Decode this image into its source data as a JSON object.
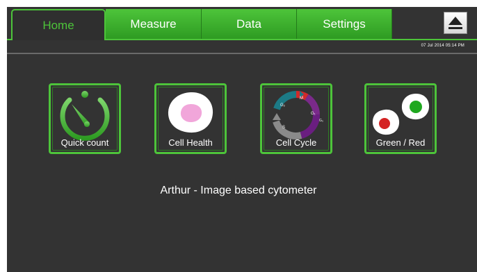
{
  "tabs": [
    {
      "label": "Home",
      "active": true
    },
    {
      "label": "Measure",
      "active": false
    },
    {
      "label": "Data",
      "active": false
    },
    {
      "label": "Settings",
      "active": false
    }
  ],
  "eject_icon": "eject-icon",
  "datetime": "07 Jul 2014  05:14 PM",
  "tiles": [
    {
      "label": "Quick count",
      "icon": "stopwatch-icon"
    },
    {
      "label": "Cell Health",
      "icon": "cell-icon"
    },
    {
      "label": "Cell Cycle",
      "icon": "cell-cycle-icon"
    },
    {
      "label": "Green / Red",
      "icon": "green-red-cells-icon"
    }
  ],
  "cell_cycle_phases": [
    "M",
    "G1",
    "G0",
    "G2",
    "S"
  ],
  "subtitle": "Arthur - Image based cytometer",
  "colors": {
    "accent": "#4dc43a",
    "background": "#333333",
    "pink": "#f1a6da",
    "red": "#d42222",
    "green": "#1fa81f"
  }
}
